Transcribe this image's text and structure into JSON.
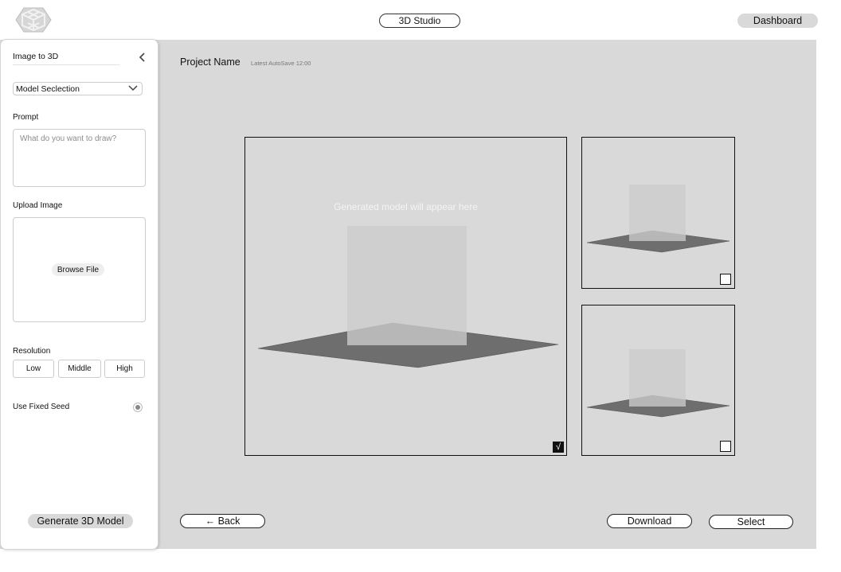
{
  "header": {
    "studio_label": "3D Studio",
    "dashboard_label": "Dashboard"
  },
  "sidebar": {
    "title": "Image to 3D",
    "model_select": "Model Seclection",
    "prompt_label": "Prompt",
    "prompt_placeholder": "What do you want to draw?",
    "upload_label": "Upload Image",
    "browse_label": "Browse File",
    "resolution_label": "Resolution",
    "resolution_options": [
      "Low",
      "Middle",
      "High"
    ],
    "fixed_seed_label": "Use Fixed Seed",
    "generate_label": "Generate 3D Model"
  },
  "project": {
    "name": "Project Name",
    "autosave": "Latest AutoSave 12:00"
  },
  "viewport": {
    "hint": "Generated model will appear here",
    "main_checked_mark": "√"
  },
  "footer": {
    "back_label": "← Back",
    "download_label": "Download",
    "select_label": "Select"
  },
  "colors": {
    "canvas": "#d9d9d9",
    "plane": "#6e6e6e",
    "box": "#cccccc"
  }
}
